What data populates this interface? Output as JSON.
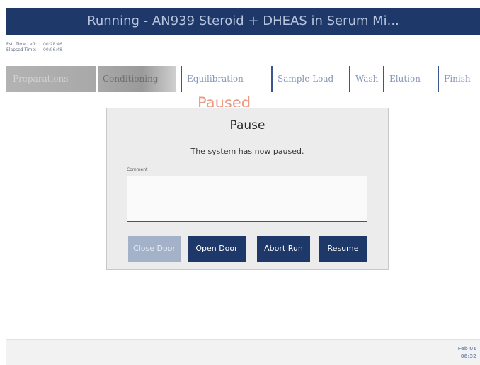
{
  "header": {
    "title": "Running - AN939 Steroid + DHEAS in Serum Mi..."
  },
  "timing": {
    "est_left_label": "Est. Time Left:",
    "est_left_value": "00:28:46",
    "elapsed_label": "Elapsed Time:",
    "elapsed_value": "00:06:48"
  },
  "steps": [
    "Preparations",
    "Conditioning",
    "Equilibration",
    "Sample Load",
    "Wash",
    "Elution",
    "Finish"
  ],
  "status_label": "Paused",
  "dialog": {
    "title": "Pause",
    "message": "The system has now paused.",
    "comment_label": "Comment",
    "comment_value": "",
    "buttons": {
      "close_door": "Close Door",
      "open_door": "Open Door",
      "abort_run": "Abort Run",
      "resume": "Resume"
    }
  },
  "footer": {
    "date": "Feb 01",
    "time": "08:32"
  },
  "colors": {
    "primary": "#1d3869",
    "disabled": "#a3b1c9",
    "paused": "#eb9a84"
  }
}
